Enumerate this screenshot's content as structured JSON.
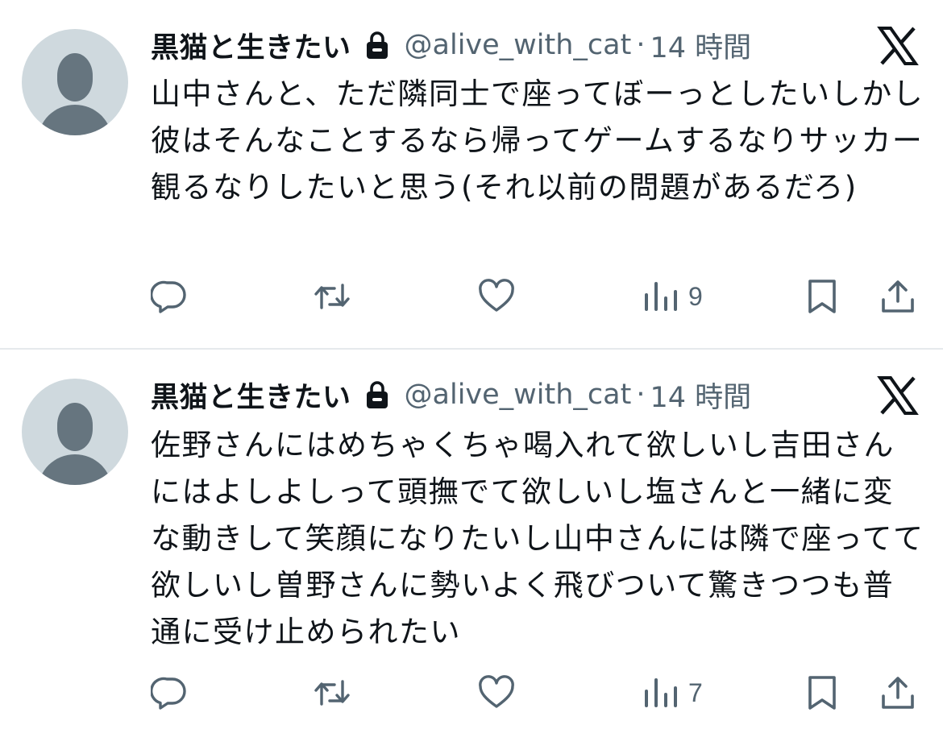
{
  "tweets": [
    {
      "author": {
        "display_name": "黒猫と生きたい",
        "handle": "@alive_with_cat",
        "protected_icon": "lock-icon"
      },
      "separator": "·",
      "time": "14 時間",
      "text": "山中さんと、ただ隣同士で座ってぼーっとしたいしかし彼はそんなことするなら帰ってゲームするなりサッカー観るなりしたいと思う(それ以前の問題があるだろ)",
      "actions": {
        "reply_icon": "reply-icon",
        "retweet_icon": "retweet-icon",
        "like_icon": "heart-icon",
        "views_icon": "bar-chart-icon",
        "views_count": "9",
        "bookmark_icon": "bookmark-icon",
        "share_icon": "share-icon"
      }
    },
    {
      "author": {
        "display_name": "黒猫と生きたい",
        "handle": "@alive_with_cat",
        "protected_icon": "lock-icon"
      },
      "separator": "·",
      "time": "14 時間",
      "text": "佐野さんにはめちゃくちゃ喝入れて欲しいし吉田さんにはよしよしって頭撫でて欲しいし塩さんと一緒に変な動きして笑顔になりたいし山中さんには隣で座ってて欲しいし曽野さんに勢いよく飛びついて驚きつつも普通に受け止められたい",
      "actions": {
        "reply_icon": "reply-icon",
        "retweet_icon": "retweet-icon",
        "like_icon": "heart-icon",
        "views_icon": "bar-chart-icon",
        "views_count": "7",
        "bookmark_icon": "bookmark-icon",
        "share_icon": "share-icon"
      }
    }
  ],
  "brand_logo": "x-logo",
  "colors": {
    "text_primary": "#0f1419",
    "text_secondary": "#536471",
    "avatar_bg": "#cfd9de",
    "avatar_fg": "#66757f",
    "divider": "#e6e9ec"
  }
}
